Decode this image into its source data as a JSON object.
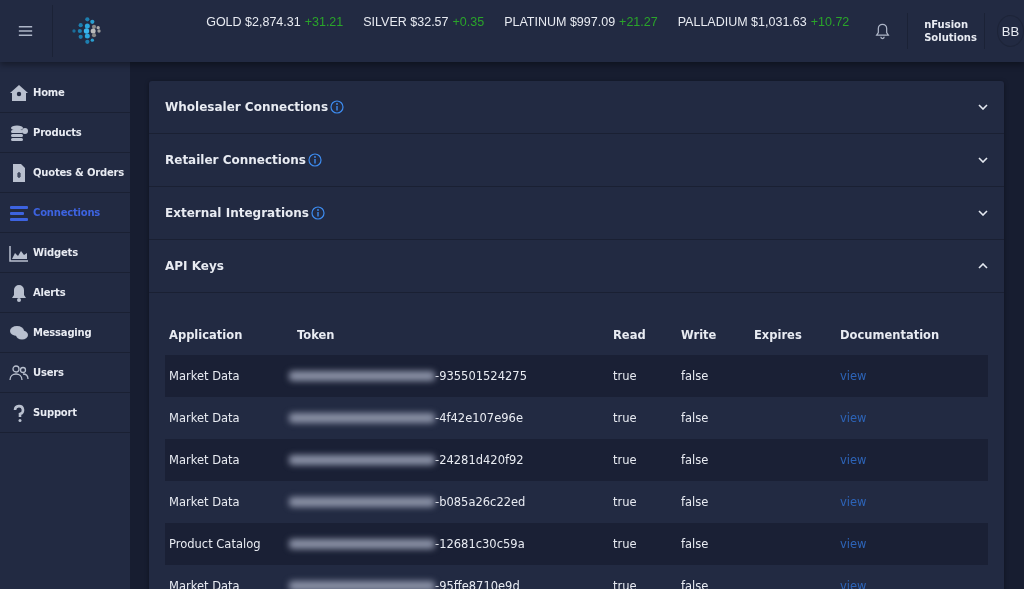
{
  "ticker": [
    {
      "metal": "GOLD",
      "price": "$2,874.31",
      "change": "+31.21"
    },
    {
      "metal": "SILVER",
      "price": "$32.57",
      "change": "+0.35"
    },
    {
      "metal": "PLATINUM",
      "price": "$997.09",
      "change": "+21.27"
    },
    {
      "metal": "PALLADIUM",
      "price": "$1,031.63",
      "change": "+10.72"
    }
  ],
  "account": {
    "company": "nFusion Solutions",
    "initials": "BB"
  },
  "sidebar": {
    "items": [
      {
        "label": "Home",
        "selected": false
      },
      {
        "label": "Products",
        "selected": false
      },
      {
        "label": "Quotes & Orders",
        "selected": false
      },
      {
        "label": "Connections",
        "selected": true
      },
      {
        "label": "Widgets",
        "selected": false
      },
      {
        "label": "Alerts",
        "selected": false
      },
      {
        "label": "Messaging",
        "selected": false
      },
      {
        "label": "Users",
        "selected": false
      },
      {
        "label": "Support",
        "selected": false
      }
    ]
  },
  "sections": [
    {
      "title": "Wholesaler Connections",
      "info": true,
      "expanded": false
    },
    {
      "title": "Retailer Connections",
      "info": true,
      "expanded": false
    },
    {
      "title": "External Integrations",
      "info": true,
      "expanded": false
    },
    {
      "title": "API Keys",
      "info": false,
      "expanded": true
    }
  ],
  "api_keys": {
    "columns": [
      "Application",
      "Token",
      "Read",
      "Write",
      "Expires",
      "Documentation"
    ],
    "rows": [
      {
        "application": "Market Data",
        "token": "-935501524275",
        "read": "true",
        "write": "false",
        "link": "view"
      },
      {
        "application": "Market Data",
        "token": "-4f42e107e96e",
        "read": "true",
        "write": "false",
        "link": "view"
      },
      {
        "application": "Market Data",
        "token": "-24281d420f92",
        "read": "true",
        "write": "false",
        "link": "view"
      },
      {
        "application": "Market Data",
        "token": "-b085a26c22ed",
        "read": "true",
        "write": "false",
        "link": "view"
      },
      {
        "application": "Product Catalog",
        "token": "-12681c30c59a",
        "read": "true",
        "write": "false",
        "link": "view"
      },
      {
        "application": "Market Data",
        "token": "-95ffe8710e9d",
        "read": "true",
        "write": "false",
        "link": "view"
      }
    ]
  }
}
